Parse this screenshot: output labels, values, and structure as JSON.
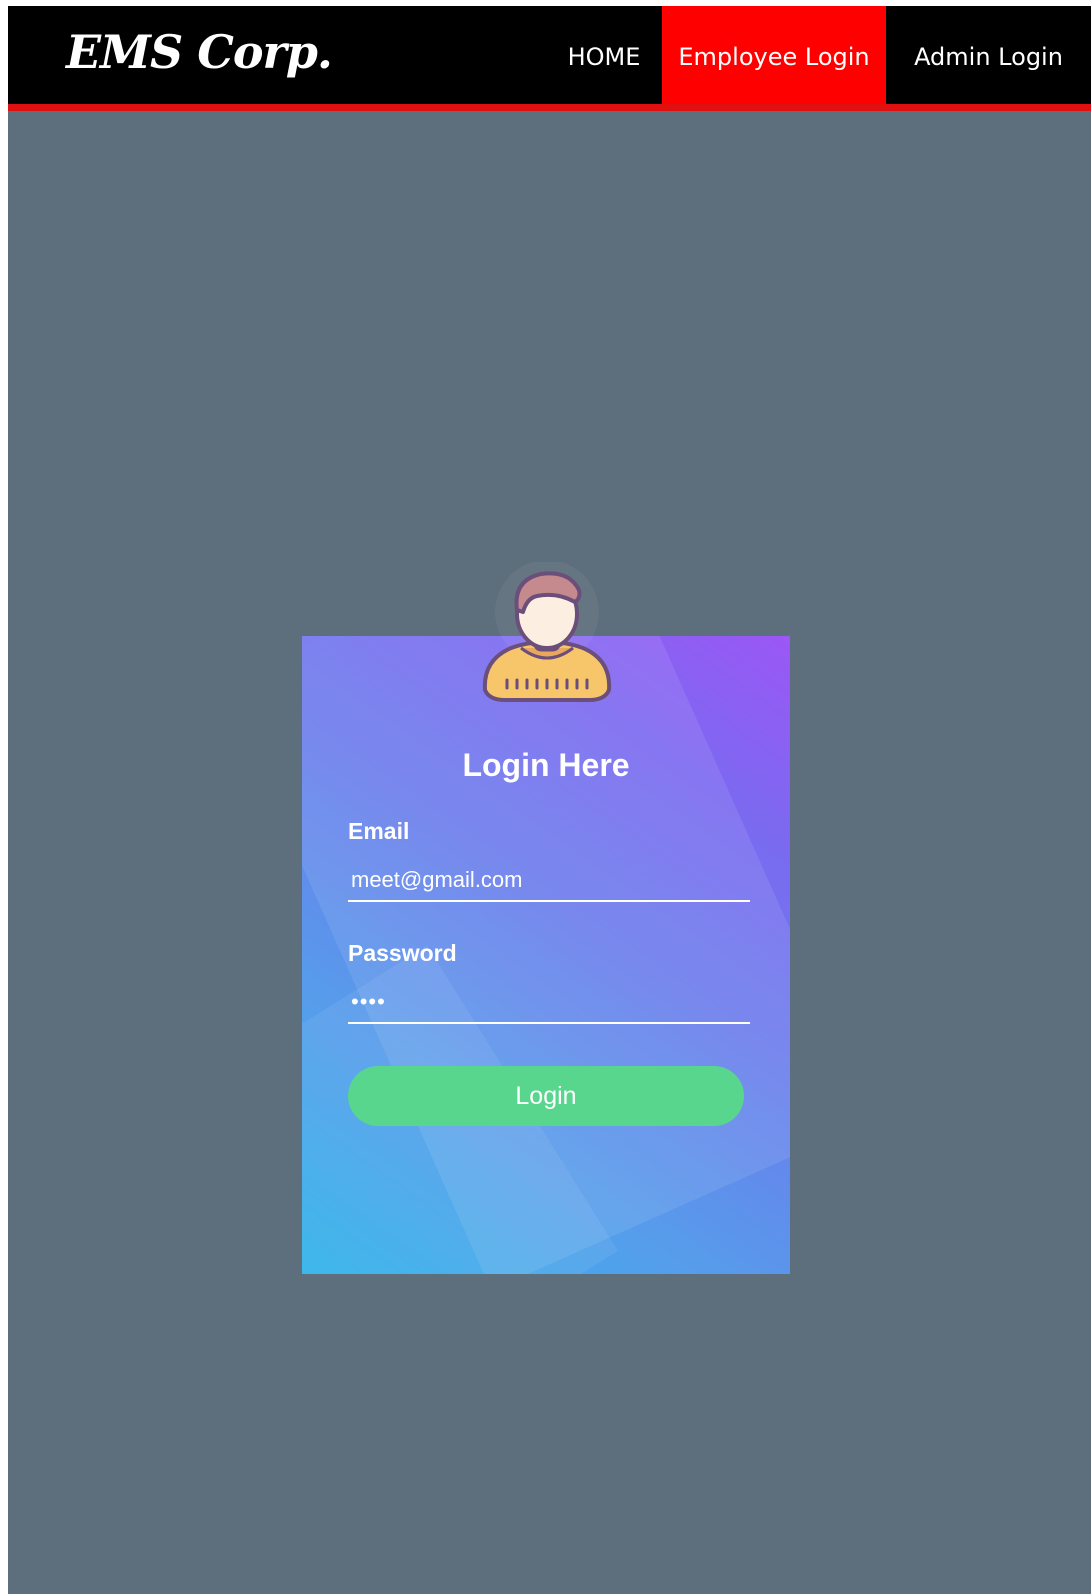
{
  "navbar": {
    "brand": "EMS Corp.",
    "items": [
      {
        "label": "HOME",
        "active": false
      },
      {
        "label": "Employee Login",
        "active": true
      },
      {
        "label": "Admin Login",
        "active": false
      }
    ]
  },
  "login_card": {
    "avatar_icon": "user-avatar-icon",
    "title": "Login Here",
    "email": {
      "label": "Email",
      "value": "meet@gmail.com"
    },
    "password": {
      "label": "Password",
      "value": "••••"
    },
    "submit_label": "Login"
  },
  "colors": {
    "page_background": "#5d6e7c",
    "navbar_background": "#000000",
    "navbar_active": "#ff0000",
    "navbar_border": "#e01010",
    "button_green": "#58d68d",
    "card_gradient_top": "#9b57f5",
    "card_gradient_bottom": "#2fb3ea"
  }
}
